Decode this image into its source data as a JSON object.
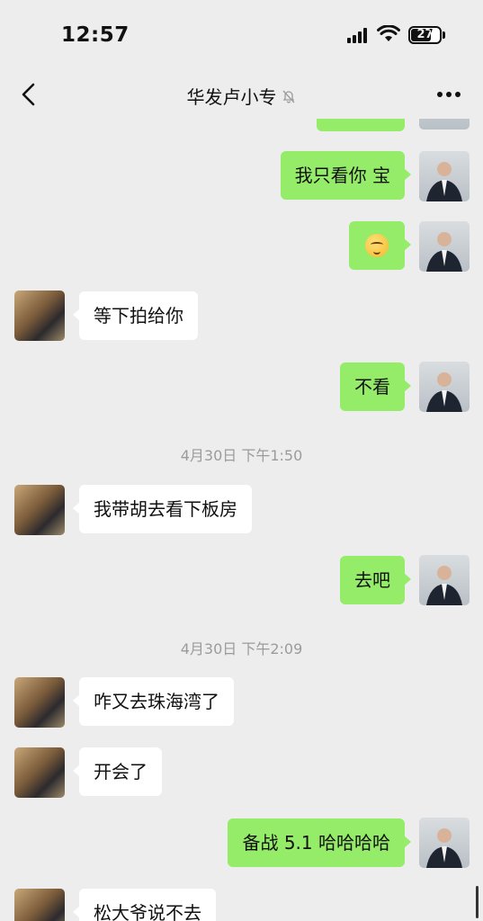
{
  "status": {
    "time": "12:57",
    "battery": "27"
  },
  "header": {
    "title": "华发卢小专"
  },
  "messages": [
    {
      "from": "me",
      "text": "我只看你 宝"
    },
    {
      "from": "me",
      "emoji": "smiling-face-emoji"
    },
    {
      "from": "them",
      "text": "等下拍给你"
    },
    {
      "from": "me",
      "text": "不看"
    },
    {
      "timestamp": "4月30日 下午1:50"
    },
    {
      "from": "them",
      "text": "我带胡去看下板房"
    },
    {
      "from": "me",
      "text": "去吧"
    },
    {
      "timestamp": "4月30日 下午2:09"
    },
    {
      "from": "them",
      "text": "咋又去珠海湾了"
    },
    {
      "from": "them",
      "text": "开会了"
    },
    {
      "from": "me",
      "text": "备战 5.1 哈哈哈哈"
    },
    {
      "from": "them",
      "text": "松大爷说不去"
    }
  ],
  "colors": {
    "me_bubble": "#95ec69",
    "them_bubble": "#ffffff",
    "background": "#ededed"
  }
}
